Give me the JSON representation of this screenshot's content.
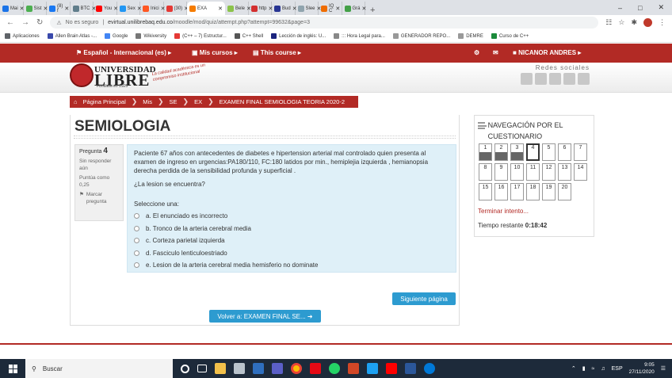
{
  "browser": {
    "tabs": [
      {
        "label": "Mai",
        "color": "#1a73e8"
      },
      {
        "label": "Sist",
        "color": "#4caf50"
      },
      {
        "label": "(8) f",
        "color": "#1877f2"
      },
      {
        "label": "BTC",
        "color": "#607d8b"
      },
      {
        "label": "You",
        "color": "#ff0000"
      },
      {
        "label": "Sex",
        "color": "#2196f3"
      },
      {
        "label": "Inici",
        "color": "#ff5722"
      },
      {
        "label": "(30)",
        "color": "#e53935"
      },
      {
        "label": "EXA",
        "color": "#f57c00",
        "active": true
      },
      {
        "label": "Bele",
        "color": "#8bc34a"
      },
      {
        "label": "http",
        "color": "#d32f2f"
      },
      {
        "label": "Bud",
        "color": "#283593"
      },
      {
        "label": "Slee",
        "color": "#90a4ae"
      },
      {
        "label": "IQ C",
        "color": "#ef6c00"
      },
      {
        "label": "Grá",
        "color": "#43a047"
      }
    ],
    "url_insecure": "No es seguro",
    "url_domain": "evirtual.unilibrebaq.edu.co",
    "url_path": "/moodle/mod/quiz/attempt.php?attempt=99632&page=3",
    "bookmarks": [
      {
        "label": "Aplicaciones",
        "color": "#5f6368"
      },
      {
        "label": "Allen Brain Atlas -...",
        "color": "#3949ab"
      },
      {
        "label": "Google",
        "color": "#4285f4"
      },
      {
        "label": "Wikiversity",
        "color": "#777777"
      },
      {
        "label": "(C++ – 7) Estructur...",
        "color": "#e53935"
      },
      {
        "label": "C++ Shell",
        "color": "#555555"
      },
      {
        "label": "Lección de inglés: U...",
        "color": "#1a237e"
      },
      {
        "label": "::: Hora Legal para...",
        "color": "#888888"
      },
      {
        "label": "GENERADOR REPO...",
        "color": "#999999"
      },
      {
        "label": "DEMRE",
        "color": "#999999"
      },
      {
        "label": "Curso de C++",
        "color": "#1b8a3a"
      }
    ]
  },
  "topnav": {
    "language": "Español - Internacional (es)",
    "courses": "Mis cursos",
    "this_course": "This course",
    "user": "NICANOR ANDRES"
  },
  "header": {
    "logo_line1": "UNIVERSIDAD",
    "logo_line2": "LIBRE",
    "logo_founded": "Fundada en 1923",
    "logo_tagline": "La calidad académica es un compromiso institucional",
    "social_label": "Redes sociales"
  },
  "breadcrumb": [
    "Página Principal",
    "Mis",
    "SE",
    "EX",
    "EXAMEN FINAL SEMIOLOGIA TEORIA 2020-2"
  ],
  "page_title": "SEMIOLOGIA",
  "question": {
    "label": "Pregunta",
    "number": "4",
    "status": "Sin responder aún",
    "score": "Puntúa como 0,25",
    "flag": "Marcar pregunta",
    "text": "Paciente 67 años  con antecedentes de diabetes e hipertension arterial  mal controlado quien presenta al examen de ingreso en  urgencias:PA180/110, FC:180 latidos por min., hemiplejia izquierda , hemianopsia derecha  perdida de la sensibilidad profunda y superficial .",
    "ask": "¿La lesion se encuentra?",
    "select_label": "Seleccione una:",
    "answers": [
      "a. El enunciado es incorrecto",
      "b. Tronco de la arteria cerebral media",
      "c. Corteza parietal izquierda",
      "d. Fasciculo  lenticuloestriado",
      "e. Lesion de la arteria cerebral media hemisferio no dominate"
    ]
  },
  "buttons": {
    "next": "Siguiente página",
    "back": "Volver a: EXAMEN FINAL SE..."
  },
  "quiz_nav": {
    "title": "NAVEGACIÓN POR EL CUESTIONARIO",
    "answered": [
      1,
      2,
      3
    ],
    "current": 4,
    "numbers": [
      "1",
      "2",
      "3",
      "4",
      "5",
      "6",
      "7",
      "8",
      "9",
      "10",
      "11",
      "12",
      "13",
      "14",
      "15",
      "16",
      "17",
      "18",
      "19",
      "20"
    ],
    "finish": "Terminar intento...",
    "time_label": "Tiempo restante",
    "time_value": "0:18:42"
  },
  "taskbar": {
    "search": "Buscar",
    "lang": "ESP",
    "time": "9:05",
    "date": "27/11/2020"
  }
}
